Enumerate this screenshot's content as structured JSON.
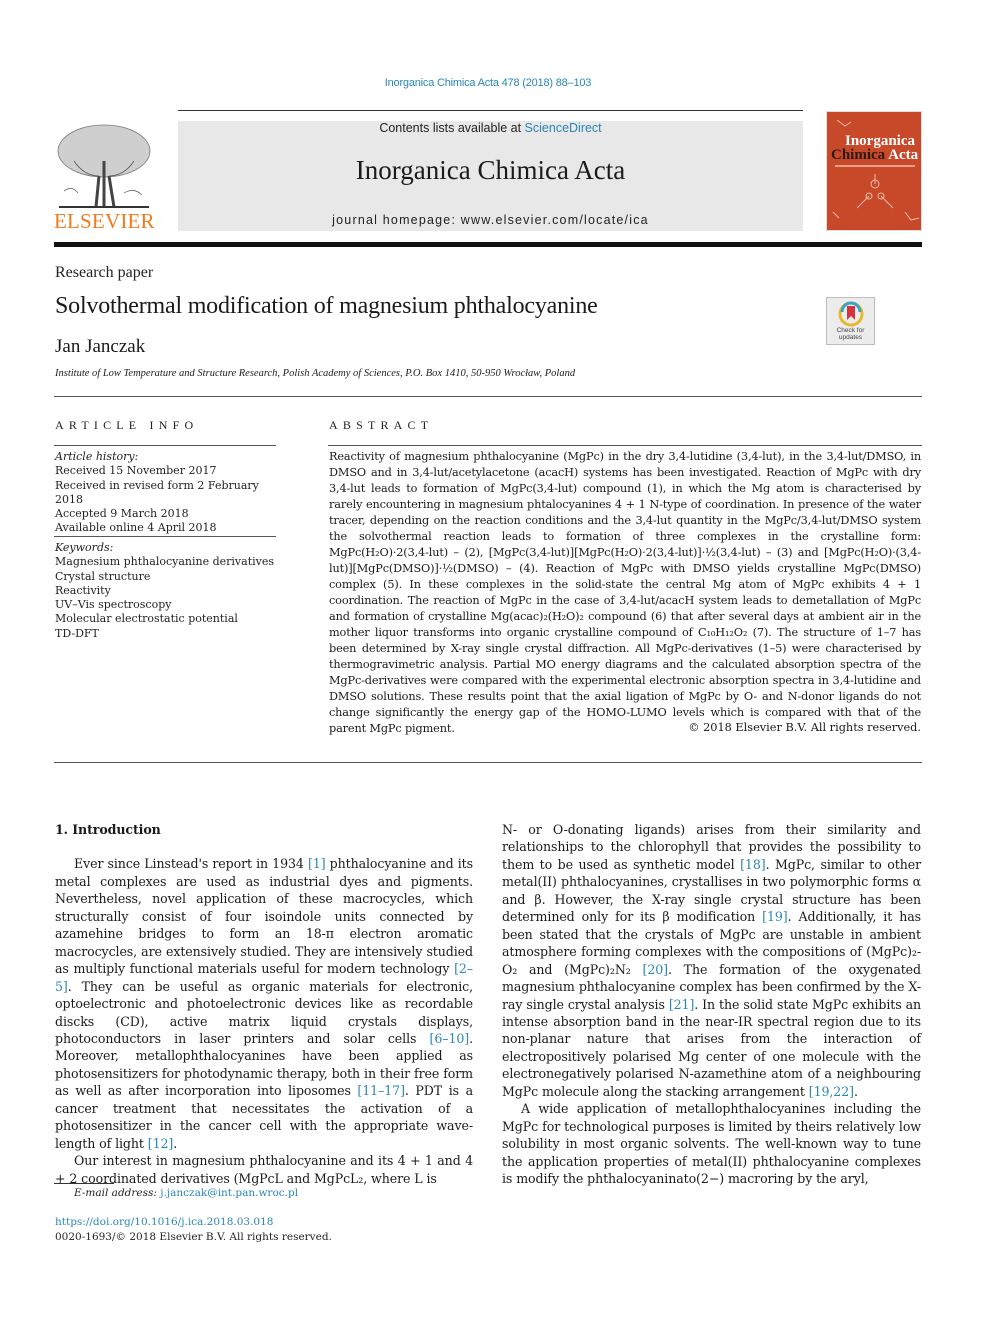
{
  "citation": "Inorganica Chimica Acta 478 (2018) 88–103",
  "header": {
    "publisher_wordmark": "ELSEVIER",
    "contents_prefix": "Contents lists available at ",
    "contents_link": "ScienceDirect",
    "journal_name": "Inorganica Chimica Acta",
    "homepage_label": "journal homepage: www.elsevier.com/locate/ica",
    "cover": {
      "title_line1": "Inorganica",
      "title_line2a": "Chimica",
      "title_line2b": "Acta",
      "color": "#c8482a"
    },
    "brand_color": "#f07b1d",
    "link_color": "#2a86b4"
  },
  "article": {
    "type": "Research paper",
    "title": "Solvothermal modification of magnesium phthalocyanine",
    "author": "Jan Janczak",
    "affiliation": "Institute of Low Temperature and Structure Research, Polish Academy of Sciences, P.O. Box 1410, 50-950 Wrocław, Poland",
    "check_updates": [
      "Check for",
      "updates"
    ]
  },
  "article_info": {
    "heading": "ARTICLE INFO",
    "history_label": "Article history:",
    "history": [
      "Received 15 November 2017",
      "Received in revised form 2 February 2018",
      "Accepted 9 March 2018",
      "Available online 4 April 2018"
    ],
    "keywords_label": "Keywords:",
    "keywords": [
      "Magnesium phthalocyanine derivatives",
      "Crystal structure",
      "Reactivity",
      "UV–Vis spectroscopy",
      "Molecular electrostatic potential",
      "TD-DFT"
    ]
  },
  "abstract": {
    "heading": "ABSTRACT",
    "text": "Reactivity of magnesium phthalocyanine (MgPc) in the dry 3,4-lutidine (3,4-lut), in the 3,4-lut/DMSO, in DMSO and in 3,4-lut/acetylacetone (acacH) systems has been investigated. Reaction of MgPc with dry 3,4-lut leads to formation of MgPc(3,4-lut) compound (1), in which the Mg atom is characterised by rarely encountering in magnesium phtalocyanines 4 + 1 N-type of coordination. In presence of the water tracer, depending on the reaction conditions and the 3,4-lut quantity in the MgPc/3,4-lut/DMSO system the solvothermal reaction leads to formation of three complexes in the crystalline form: MgPc(H₂O)·2(3,4-lut) – (2), [MgPc(3,4-lut)][MgPc(H₂O)·2(3,4-lut)]·½(3,4-lut) – (3) and [MgPc(H₂O)·(3,4-lut)][MgPc(DMSO)]·½(DMSO) – (4). Reaction of MgPc with DMSO yields crystalline MgPc(DMSO) complex (5). In these complexes in the solid-state the central Mg atom of MgPc exhibits 4 + 1 coordination. The reaction of MgPc in the case of 3,4-lut/acacH system leads to demetallation of MgPc and formation of crystalline Mg(acac)₂(H₂O)₂ compound (6) that after several days at ambient air in the mother liquor transforms into organic crystalline compound of C₁₀H₁₂O₂ (7). The structure of 1–7 has been determined by X-ray single crystal diffraction. All MgPc-derivatives (1–5) were characterised by thermogravimetric analysis. Partial MO energy diagrams and the calculated absorption spectra of the MgPc-derivatives were compared with the experimental electronic absorption spectra in 3,4-lutidine and DMSO solutions. These results point that the axial ligation of MgPc by O- and N-donor ligands do not change significantly the energy gap of the HOMO-LUMO levels which is compared with that of the parent MgPc pigment.",
    "copyright": "© 2018 Elsevier B.V. All rights reserved."
  },
  "body": {
    "section_heading": "1. Introduction",
    "left_paragraphs": [
      {
        "segments": [
          {
            "t": "Ever since Linstead's report in 1934 "
          },
          {
            "ref": "[1]"
          },
          {
            "t": " phthalocyanine and its metal complexes are used as industrial dyes and pigments. Nevertheless, novel application of these macrocycles, which structurally consist of four isoindole units connected by azamehine bridges to form an 18-π electron aromatic macrocycles, are extensively studied. They are intensively studied as multiply functional materials useful for modern technology "
          },
          {
            "ref": "[2–5]"
          },
          {
            "t": ". They can be useful as organic materials for electronic, optoelectronic and photoelectronic devices like as recordable discks (CD), active matrix liquid crystals displays, photoconductors in laser printers and solar cells "
          },
          {
            "ref": "[6–10]"
          },
          {
            "t": ". Moreover, metallophthalocyanines have been applied as photosensitizers for photodynamic therapy, both in their free form as well as after incorporation into liposomes "
          },
          {
            "ref": "[11–17]"
          },
          {
            "t": ". PDT is a cancer treatment that necessitates the activation of a photosensitizer in the cancer cell with the appropriate wave-length of light "
          },
          {
            "ref": "[12]"
          },
          {
            "t": "."
          }
        ]
      },
      {
        "segments": [
          {
            "t": "Our interest in magnesium phthalocyanine and its 4 + 1 and 4 + 2 coordinated derivatives (MgPcL and MgPcL₂, where L is"
          }
        ]
      }
    ],
    "right_paragraphs": [
      {
        "continuation": true,
        "segments": [
          {
            "t": "N- or O-donating ligands) arises from their similarity and relationships to the chlorophyll that provides the possibility to them to be used as synthetic model "
          },
          {
            "ref": "[18]"
          },
          {
            "t": ". MgPc, similar to other metal(II) phthalocyanines, crystallises in two polymorphic forms α and β. However, the X-ray single crystal structure has been determined only for its β modification "
          },
          {
            "ref": "[19]"
          },
          {
            "t": ". Additionally, it has been stated that the crystals of MgPc are unstable in ambient atmosphere forming complexes with the compositions of (MgPc)₂-O₂ and (MgPc)₂N₂ "
          },
          {
            "ref": "[20]"
          },
          {
            "t": ". The formation of the oxygenated magnesium phthalocyanine complex has been confirmed by the X-ray single crystal analysis "
          },
          {
            "ref": "[21]"
          },
          {
            "t": ". In the solid state MgPc exhibits an intense absorption band in the near-IR spectral region due to its non-planar nature that arises from the interaction of electropositively polarised Mg center of one molecule with the electronegatively polarised N-azamethine atom of a neighbouring MgPc molecule along the stacking arrangement "
          },
          {
            "ref": "[19,22]"
          },
          {
            "t": "."
          }
        ]
      },
      {
        "segments": [
          {
            "t": "A wide application of metallophthalocyanines including the MgPc for technological purposes is limited by theirs relatively low solubility in most organic solvents. The well-known way to tune the application properties of metal(II) phthalocyanine complexes is modify the phthalocyaninato(2−) macroring by the aryl,"
          }
        ]
      }
    ]
  },
  "footnote": {
    "email_label": "E-mail address: ",
    "email": "j.janczak@int.pan.wroc.pl",
    "doi": "https://doi.org/10.1016/j.ica.2018.03.018",
    "issn_line": "0020-1693/© 2018 Elsevier B.V. All rights reserved."
  }
}
